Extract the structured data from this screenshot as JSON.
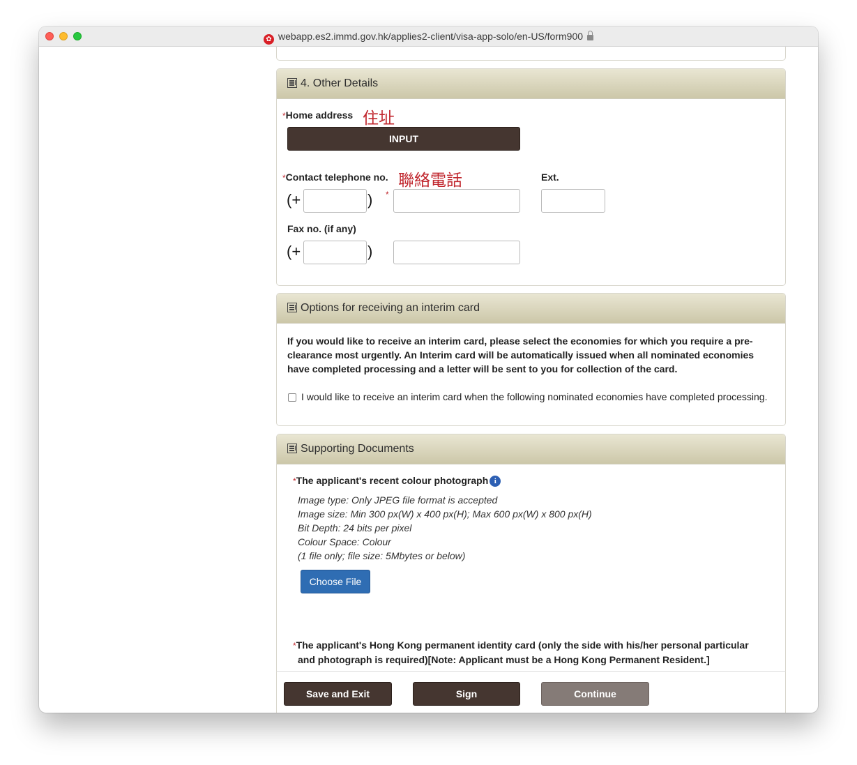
{
  "browser": {
    "url": "webapp.es2.immd.gov.hk/applies2-client/visa-app-solo/en-US/form900"
  },
  "other_details": {
    "title": "4. Other Details",
    "home_address_label": "Home address",
    "home_address_zh": "住址",
    "input_button": "INPUT",
    "contact_tel_label": "Contact telephone no.",
    "contact_tel_zh": "聯絡電話",
    "ext_label": "Ext.",
    "fax_label": "Fax no. (if any)",
    "paren_open": "(+",
    "paren_close": ")",
    "required_mark": "*"
  },
  "interim_card": {
    "title": "Options for receiving an interim card",
    "description": "If you would like to receive an interim card, please select the economies for which you require a pre-clearance most urgently. An Interim card will be automatically issued when all nominated economies have completed processing and a letter will be sent to you for collection of the card.",
    "checkbox_label": "I would like to receive an interim card when the following nominated economies have completed processing."
  },
  "supporting_documents": {
    "title": "Supporting Documents",
    "photo_label": "The applicant's recent colour photograph",
    "info_glyph": "i",
    "photo_requirements": [
      "Image type: Only JPEG file format is accepted",
      "Image size: Min 300 px(W) x 400 px(H); Max 600 px(W) x 800 px(H)",
      "Bit Depth: 24 bits per pixel",
      "Colour Space: Colour",
      "(1 file only; file size: 5Mbytes or below)"
    ],
    "choose_file": "Choose File",
    "hkid_label_line1": "The applicant's Hong Kong permanent identity card (only the side with his/her personal particular",
    "hkid_label_line2": "and photograph is required)[Note: Applicant must be a Hong Kong Permanent Resident.]"
  },
  "footer": {
    "save_exit": "Save and Exit",
    "sign": "Sign",
    "continue": "Continue"
  }
}
